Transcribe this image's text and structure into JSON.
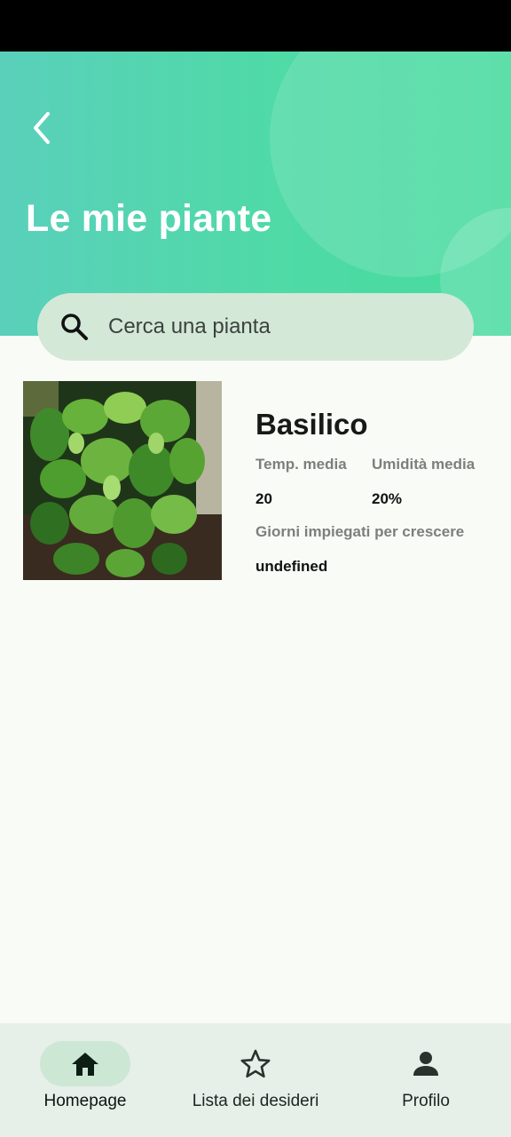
{
  "header": {
    "title": "Le mie piante",
    "back_icon": "chevron-left-icon"
  },
  "search": {
    "placeholder": "Cerca una pianta",
    "icon": "search-icon"
  },
  "plants": [
    {
      "name": "Basilico",
      "temp_label": "Temp. media",
      "temp_value": "20",
      "humidity_label": "Umidità media",
      "humidity_value": "20%",
      "grow_label": "Giorni impiegati per crescere",
      "grow_value": "undefined"
    }
  ],
  "nav": {
    "items": [
      {
        "label": "Homepage",
        "icon": "home-icon",
        "active": true
      },
      {
        "label": "Lista dei desideri",
        "icon": "star-icon",
        "active": false
      },
      {
        "label": "Profilo",
        "icon": "person-icon",
        "active": false
      }
    ]
  },
  "colors": {
    "header_start": "#5ad0bb",
    "header_end": "#47db9e",
    "search_bg": "#d4e8d7",
    "nav_bg": "#e7efe9",
    "nav_active_pill": "#cde7d5",
    "page_bg": "#f8fbf6"
  }
}
